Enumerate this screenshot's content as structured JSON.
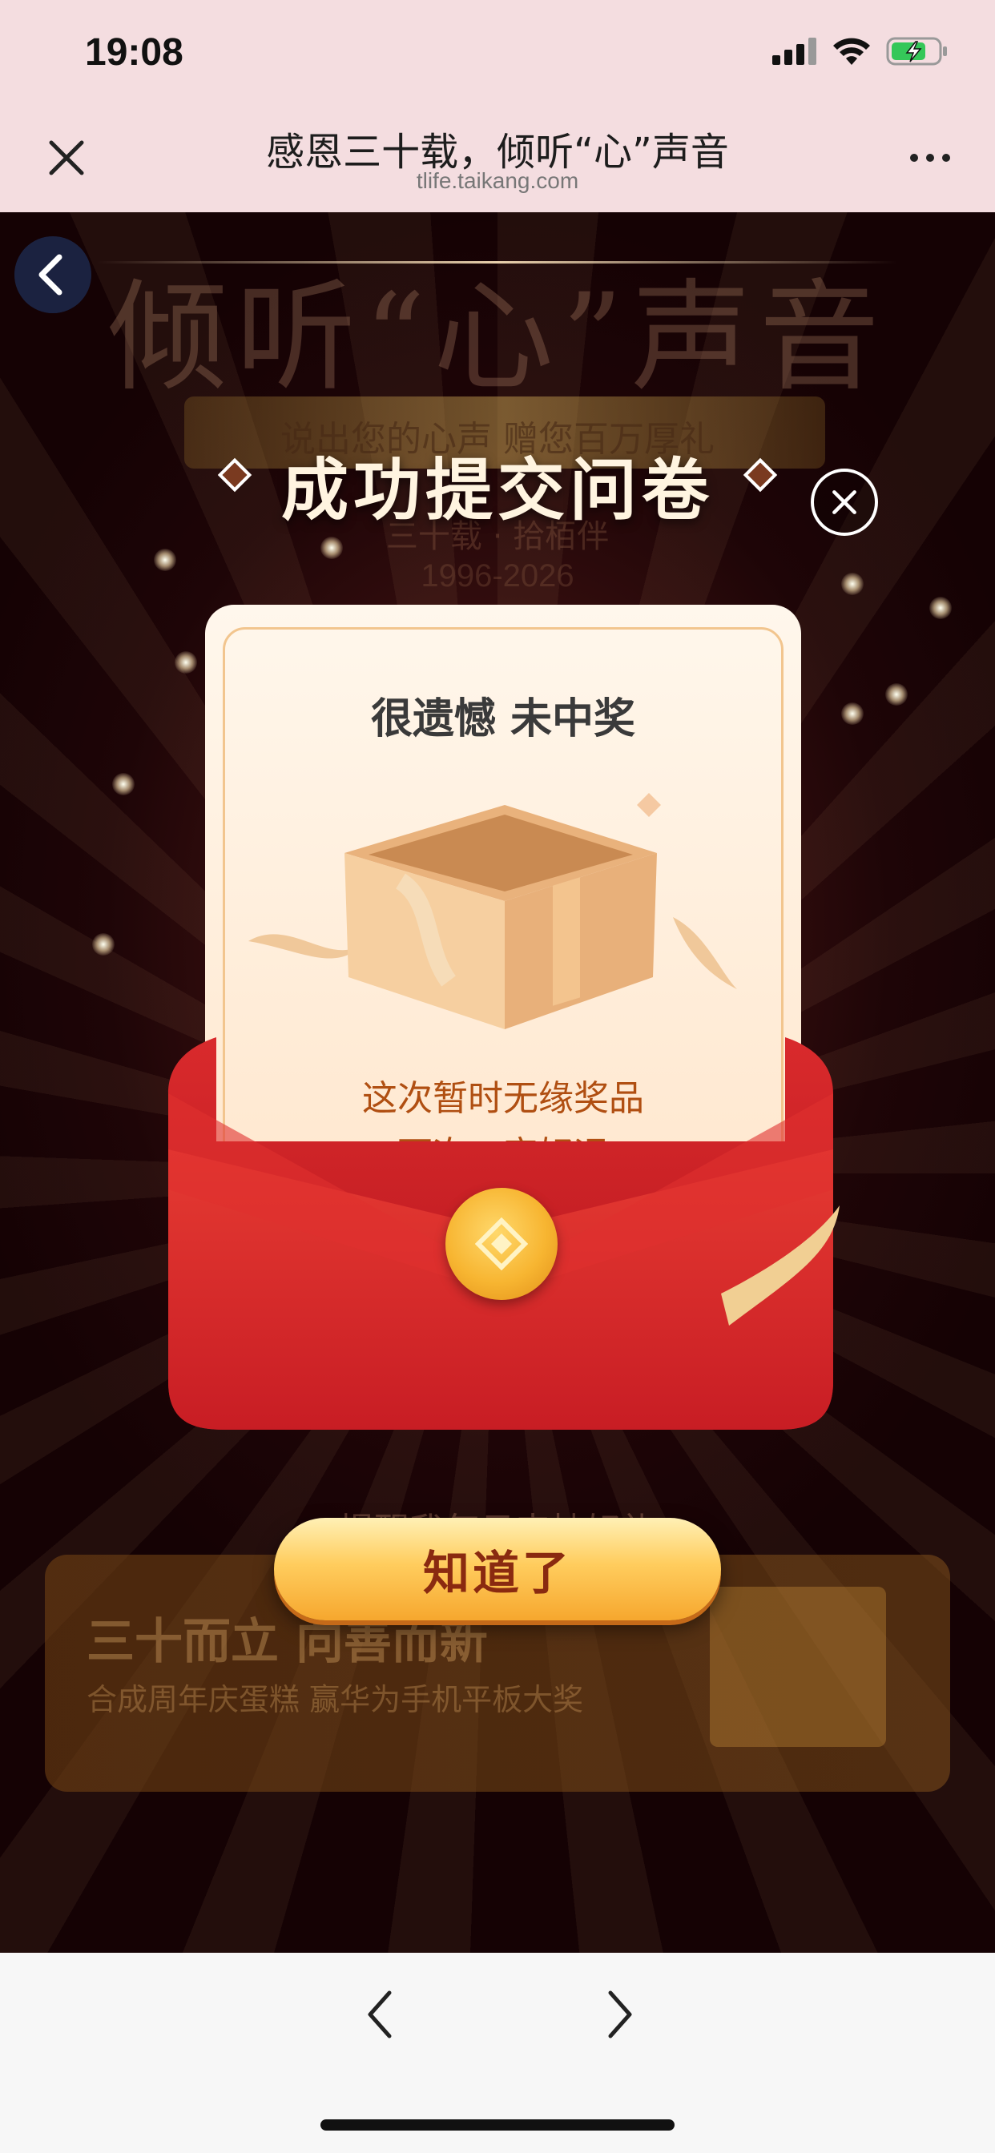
{
  "status_bar": {
    "time": "19:08"
  },
  "nav_bar": {
    "title": "感恩三十载，倾听“心”声音",
    "domain": "tlife.taikang.com"
  },
  "background": {
    "heading": "倾听“心”声音",
    "ribbon_text": "说出您的心声 赠您百万厚礼",
    "small_text": "三十载 · 拾栢伴",
    "years": "1996-2026"
  },
  "modal": {
    "success_title": "成功提交问卷",
    "card_title": "很遗憾 未中奖",
    "message_line1": "这次暂时无缘奖品",
    "message_line2": "下次一定好运",
    "ok_button": "知道了"
  },
  "reminder_text": "提醒我每日来抽好礼",
  "promo_banner": {
    "title": "三十而立 向善而新",
    "subtitle": "合成周年庆蛋糕 赢华为手机平板大奖"
  },
  "colors": {
    "status_bg": "#f4dde0",
    "envelope_red": "#d8232a",
    "button_gold": "#ffcd5e",
    "message_orange": "#b04f12"
  }
}
